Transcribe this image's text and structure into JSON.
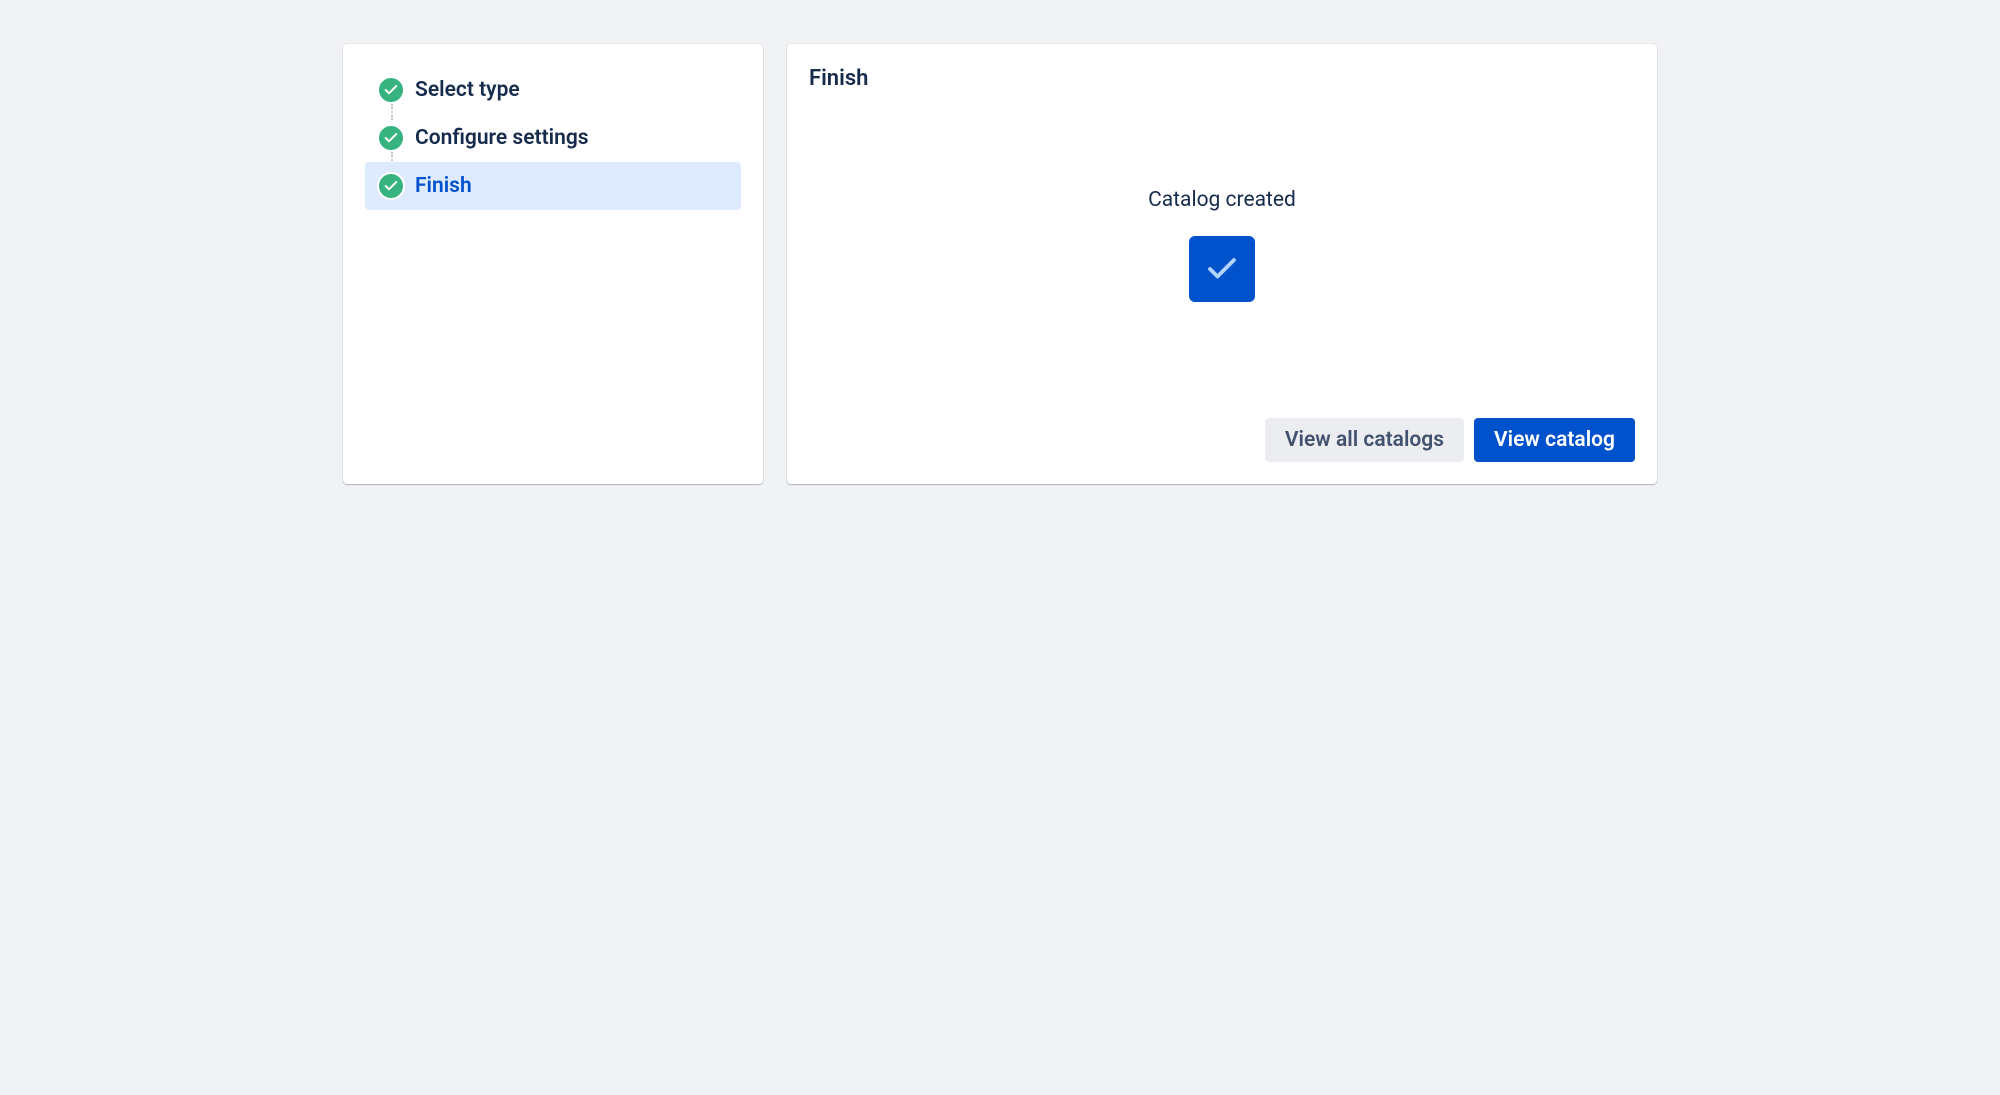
{
  "sidebar": {
    "steps": [
      {
        "label": "Select type",
        "completed": true,
        "active": false
      },
      {
        "label": "Configure settings",
        "completed": true,
        "active": false
      },
      {
        "label": "Finish",
        "completed": true,
        "active": true
      }
    ]
  },
  "main": {
    "title": "Finish",
    "status_message": "Catalog created",
    "actions": {
      "secondary_label": "View all catalogs",
      "primary_label": "View catalog"
    }
  }
}
